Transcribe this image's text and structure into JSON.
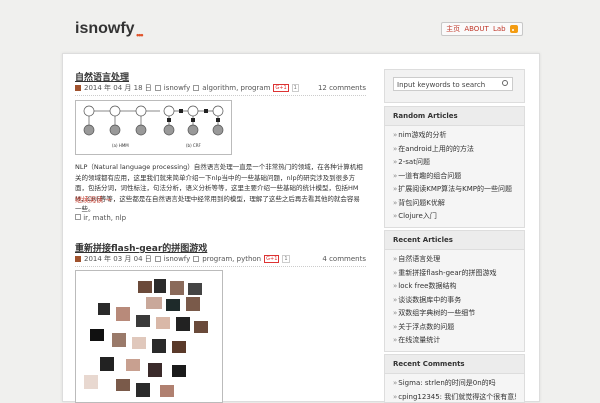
{
  "header": {
    "logo": "isnowfy",
    "logo_dots": "•••",
    "nav": [
      "主页",
      "ABOUT",
      "Lab"
    ]
  },
  "posts": [
    {
      "title": "自然语言处理",
      "date": "2014 年 04 月 18 日",
      "author": "isnowfy",
      "categories": "algorithm, program",
      "gplus": "G+1",
      "gplus_count": "1",
      "comments": "12 comments",
      "body": "NLP（Natural language processing）自然语言处理一直是一个非常热门的领域，在各种计算机相关的领域都有应用，这里我们就来简单介绍一下nlp当中的一些基础问题，nlp的研究涉及到很多方面，包括分词，词性标注，句法分析，语义分析等等，这里主要介绍一些基础的统计模型，包括HMM，CRF等等，这些都是在自然语言处理中经常用到的模型，理解了这些之后再去看其他的就会容易一些。",
      "more": "继续阅读 →",
      "tags": "ir, math, nlp",
      "diagram_labels": [
        "(a) HMM",
        "(b) CRF"
      ]
    },
    {
      "title": "重新拼接flash-gear的拼图游戏",
      "date": "2014 年 03 月 04 日",
      "author": "isnowfy",
      "categories": "program, python",
      "gplus": "G+1",
      "gplus_count": "1",
      "comments": "4 comments"
    }
  ],
  "search": {
    "placeholder": "Input keywords to search"
  },
  "random_articles": {
    "title": "Random Articles",
    "items": [
      "nim游戏的分析",
      "在android上用的的方法",
      "2-sat问题",
      "一道有趣的组合问题",
      "扩展阅读KMP算法与KMP的一些问题",
      "背包问题K优解",
      "Clojure入门"
    ]
  },
  "recent_articles": {
    "title": "Recent Articles",
    "items": [
      "自然语言处理",
      "重新拼接flash-gear的拼图游戏",
      "lock free数据结构",
      "谈谈数据库中的事务",
      "双数组字典树的一些细节",
      "关于浮点数的问题",
      "在线流量统计"
    ]
  },
  "recent_comments": {
    "title": "Recent Comments",
    "items": [
      "Sigma: strlen的时间是0n的吗",
      "cping12345: 我们就觉得这个很有意思..."
    ]
  },
  "colors": {
    "accent": "#c0392b",
    "brand_dots": "#e0532a",
    "rss": "#f39c12"
  }
}
